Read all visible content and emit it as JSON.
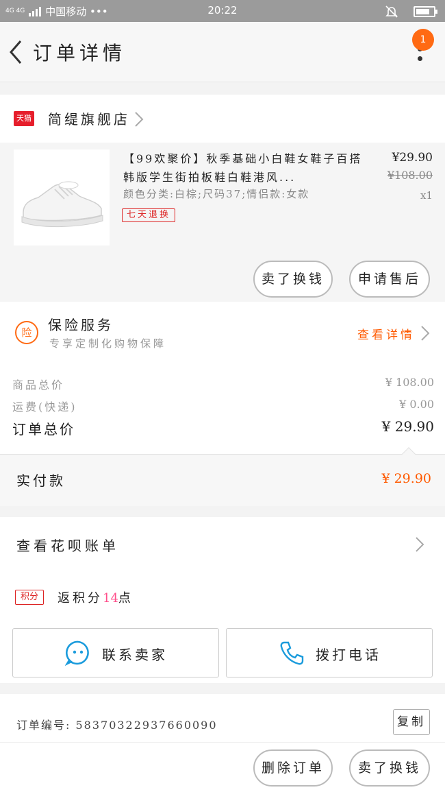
{
  "status_bar": {
    "network": "4G 4G",
    "carrier": "中国移动 •••",
    "time": "20:22",
    "battery_level": 0.8
  },
  "nav": {
    "title": "订单详情",
    "badge_count": "1"
  },
  "shop": {
    "platform_tag": "天猫",
    "name": "简缇旗舰店"
  },
  "item": {
    "title": "【99欢聚价】秋季基础小白鞋女鞋子百搭韩版学生街拍板鞋白鞋港风...",
    "sku": "颜色分类:白棕;尺码37;情侣款:女款",
    "tag": "七天退换",
    "price": "¥29.90",
    "original_price": "¥108.00",
    "quantity": "x1",
    "buttons": {
      "resell": "卖了换钱",
      "after_sale": "申请售后"
    }
  },
  "insurance": {
    "icon_text": "险",
    "title": "保险服务",
    "subtitle": "专享定制化购物保障",
    "link": "查看详情"
  },
  "summary": {
    "goods_label": "商品总价",
    "goods_value": "¥ 108.00",
    "shipping_label": "运费(快递)",
    "shipping_value": "¥ 0.00",
    "total_label": "订单总价",
    "total_value": "¥ 29.90"
  },
  "paid": {
    "label": "实付款",
    "value": "¥ 29.90"
  },
  "huabei": {
    "label": "查看花呗账单"
  },
  "points": {
    "tag": "积分",
    "prefix": "返积分",
    "count": "14",
    "suffix": "点"
  },
  "contact": {
    "seller_label": "联系卖家",
    "phone_label": "拨打电话"
  },
  "order": {
    "number_line": "订单编号: 58370322937660090",
    "copy_label": "复制"
  },
  "bottom": {
    "delete_label": "删除订单",
    "resell_label": "卖了换钱"
  },
  "colors": {
    "accent": "#ff5a00",
    "tmall_red": "#e61e2b",
    "points_pink": "#ff4f8b"
  }
}
